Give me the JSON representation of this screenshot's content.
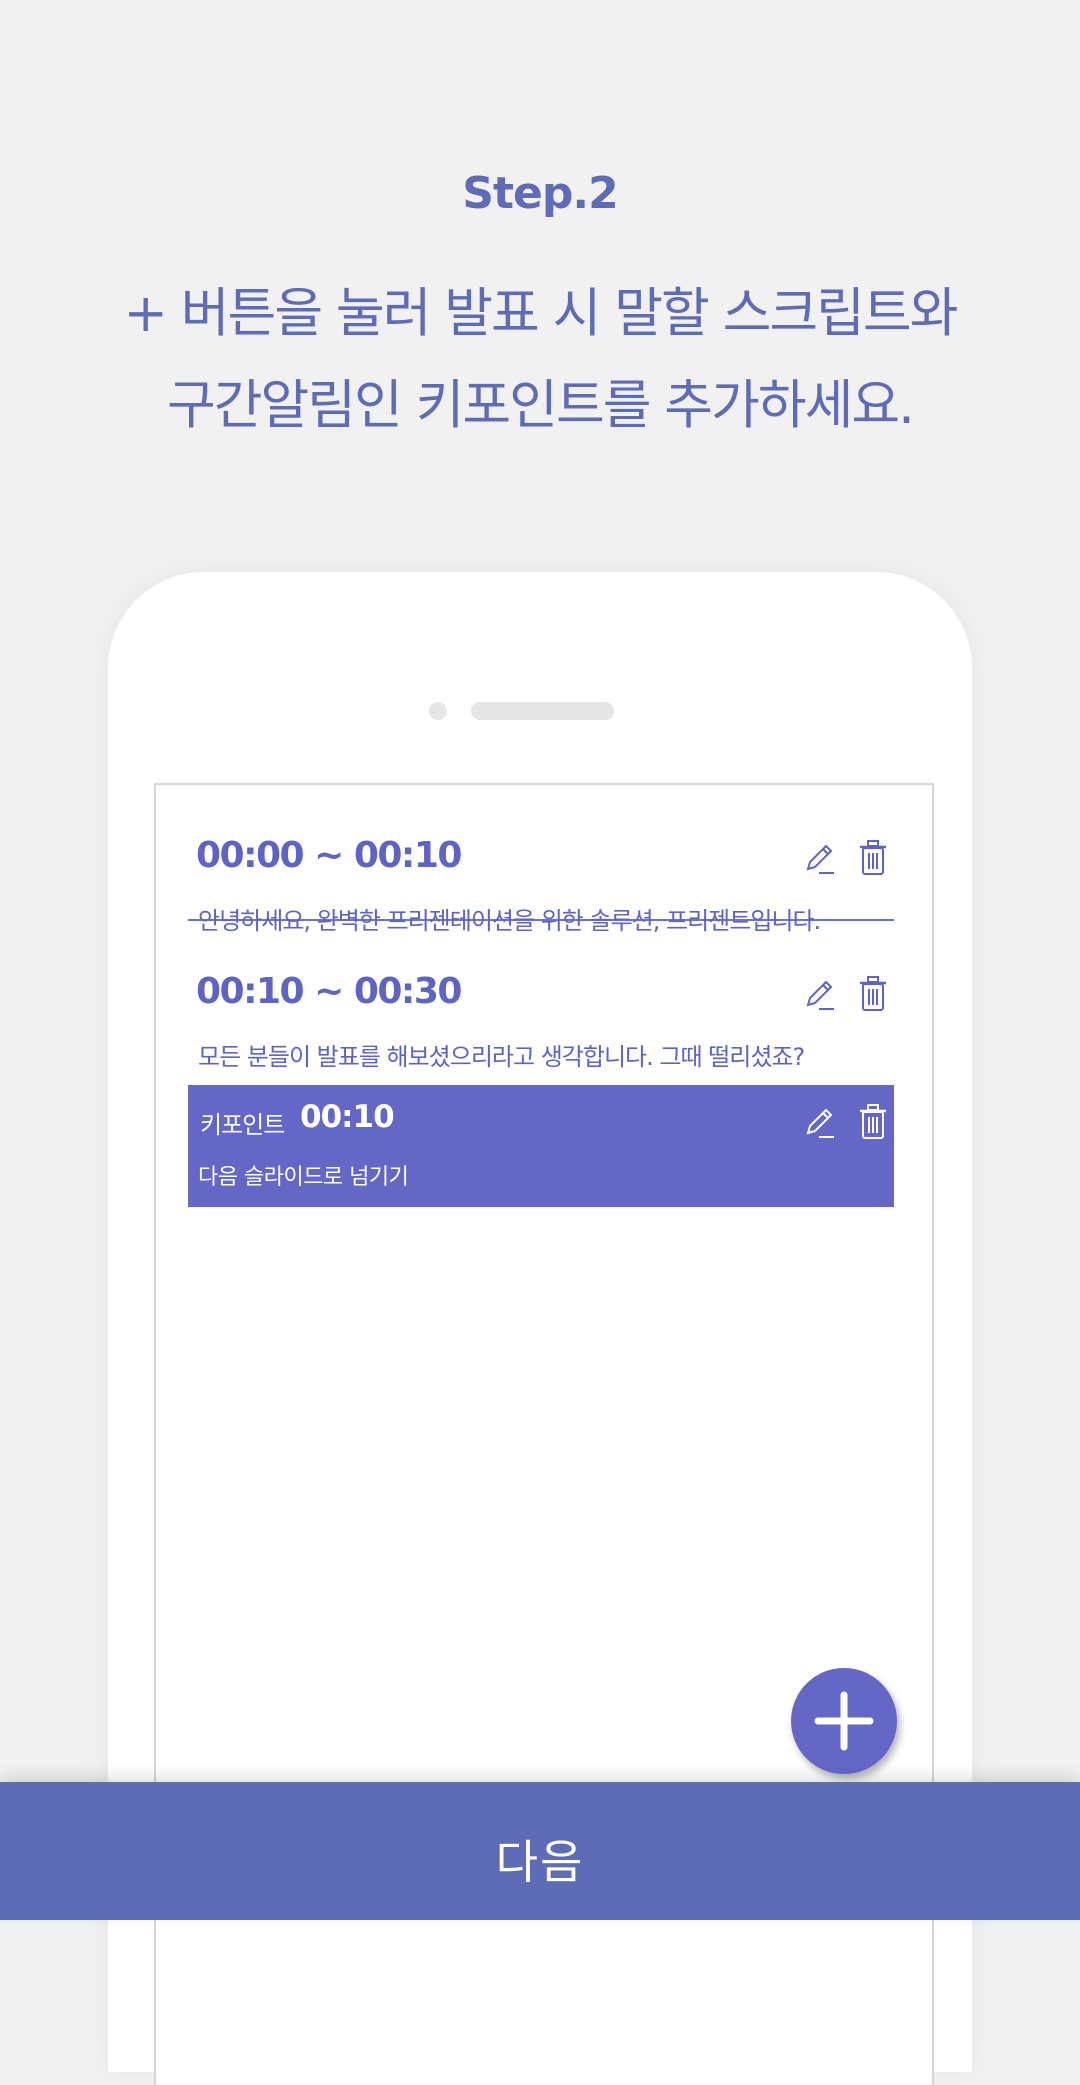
{
  "header": {
    "step": "Step.2",
    "lines": [
      "+ 버튼을 눌러 발표 시 말할 스크립트와",
      "구간알림인 키포인트를 추가하세요."
    ]
  },
  "scripts": [
    {
      "time": "00:00 ~ 00:10",
      "text": "안녕하세요, 완벽한 프리젠테이션을 위한 솔루션, 프리젠트입니다."
    },
    {
      "time": "00:10 ~ 00:30",
      "text": "모든 분들이 발표를 해보셨으리라고 생각합니다. 그때 떨리셨죠?"
    }
  ],
  "keypoint": {
    "label": "키포인트",
    "time": "00:10",
    "text": "다음 슬라이드로 넘기기"
  },
  "icons": {
    "edit": "pencil-icon",
    "delete": "trash-icon",
    "add": "plus-icon"
  },
  "footer": {
    "next_label": "다음"
  },
  "colors": {
    "accent": "#5e6cb8",
    "keypoint_bg": "#6567c6",
    "background": "#f1f1f1"
  }
}
